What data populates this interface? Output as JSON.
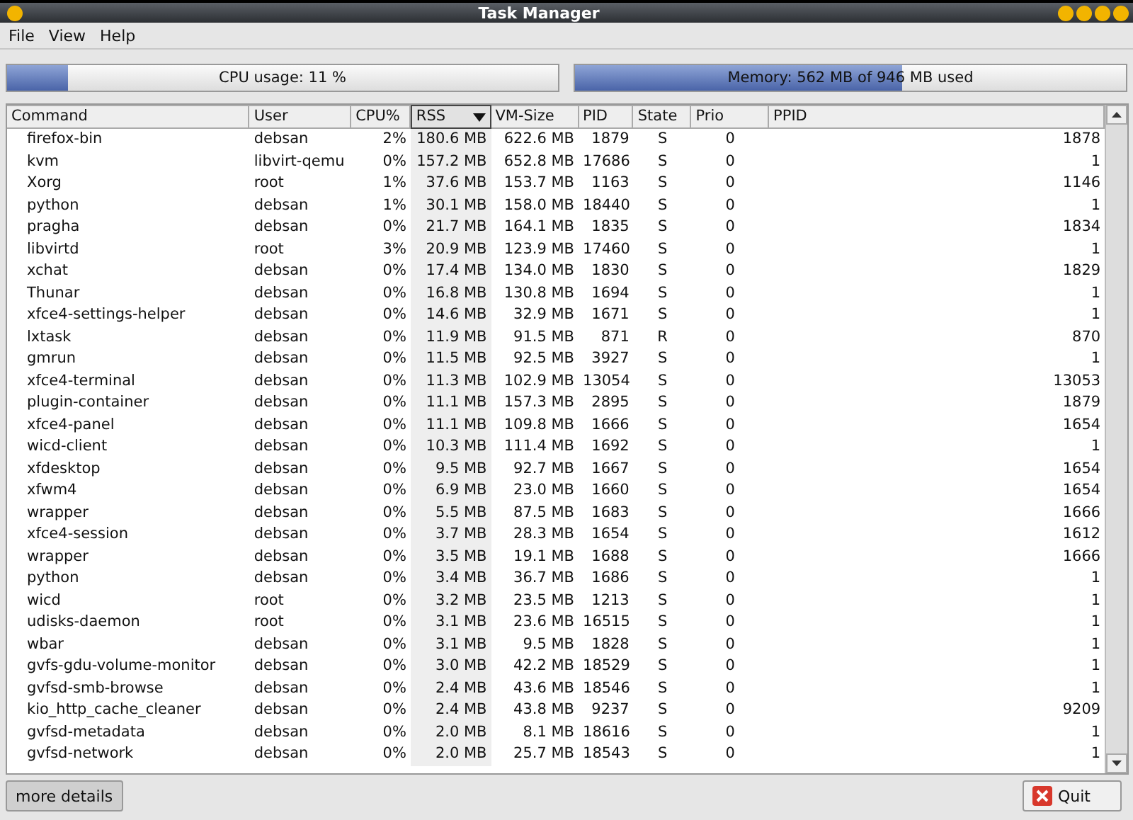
{
  "window": {
    "title": "Task Manager"
  },
  "menu": [
    "File",
    "View",
    "Help"
  ],
  "cpu": {
    "label": "CPU usage: 11 %",
    "level": 0.11
  },
  "memory": {
    "label": "Memory: 562 MB of 946 MB used",
    "level": 0.594
  },
  "table": {
    "columns": [
      {
        "label": "Command",
        "sorted": false
      },
      {
        "label": "User",
        "sorted": false
      },
      {
        "label": "CPU%",
        "sorted": false
      },
      {
        "label": "RSS",
        "sorted": true
      },
      {
        "label": "VM-Size",
        "sorted": false
      },
      {
        "label": "PID",
        "sorted": false
      },
      {
        "label": "State",
        "sorted": false
      },
      {
        "label": "Prio",
        "sorted": false
      },
      {
        "label": "PPID",
        "sorted": false
      }
    ],
    "rows": [
      [
        "firefox-bin",
        "debsan",
        "2%",
        "180.6 MB",
        "622.6 MB",
        "1879",
        "S",
        "0",
        "1878"
      ],
      [
        "kvm",
        "libvirt-qemu",
        "0%",
        "157.2 MB",
        "652.8 MB",
        "17686",
        "S",
        "0",
        "1"
      ],
      [
        "Xorg",
        "root",
        "1%",
        "37.6 MB",
        "153.7 MB",
        "1163",
        "S",
        "0",
        "1146"
      ],
      [
        "python",
        "debsan",
        "1%",
        "30.1 MB",
        "158.0 MB",
        "18440",
        "S",
        "0",
        "1"
      ],
      [
        "pragha",
        "debsan",
        "0%",
        "21.7 MB",
        "164.1 MB",
        "1835",
        "S",
        "0",
        "1834"
      ],
      [
        "libvirtd",
        "root",
        "3%",
        "20.9 MB",
        "123.9 MB",
        "17460",
        "S",
        "0",
        "1"
      ],
      [
        "xchat",
        "debsan",
        "0%",
        "17.4 MB",
        "134.0 MB",
        "1830",
        "S",
        "0",
        "1829"
      ],
      [
        "Thunar",
        "debsan",
        "0%",
        "16.8 MB",
        "130.8 MB",
        "1694",
        "S",
        "0",
        "1"
      ],
      [
        "xfce4-settings-helper",
        "debsan",
        "0%",
        "14.6 MB",
        "32.9 MB",
        "1671",
        "S",
        "0",
        "1"
      ],
      [
        "lxtask",
        "debsan",
        "0%",
        "11.9 MB",
        "91.5 MB",
        "871",
        "R",
        "0",
        "870"
      ],
      [
        "gmrun",
        "debsan",
        "0%",
        "11.5 MB",
        "92.5 MB",
        "3927",
        "S",
        "0",
        "1"
      ],
      [
        "xfce4-terminal",
        "debsan",
        "0%",
        "11.3 MB",
        "102.9 MB",
        "13054",
        "S",
        "0",
        "13053"
      ],
      [
        "plugin-container",
        "debsan",
        "0%",
        "11.1 MB",
        "157.3 MB",
        "2895",
        "S",
        "0",
        "1879"
      ],
      [
        "xfce4-panel",
        "debsan",
        "0%",
        "11.1 MB",
        "109.8 MB",
        "1666",
        "S",
        "0",
        "1654"
      ],
      [
        "wicd-client",
        "debsan",
        "0%",
        "10.3 MB",
        "111.4 MB",
        "1692",
        "S",
        "0",
        "1"
      ],
      [
        "xfdesktop",
        "debsan",
        "0%",
        "9.5 MB",
        "92.7 MB",
        "1667",
        "S",
        "0",
        "1654"
      ],
      [
        "xfwm4",
        "debsan",
        "0%",
        "6.9 MB",
        "23.0 MB",
        "1660",
        "S",
        "0",
        "1654"
      ],
      [
        "wrapper",
        "debsan",
        "0%",
        "5.5 MB",
        "87.5 MB",
        "1683",
        "S",
        "0",
        "1666"
      ],
      [
        "xfce4-session",
        "debsan",
        "0%",
        "3.7 MB",
        "28.3 MB",
        "1654",
        "S",
        "0",
        "1612"
      ],
      [
        "wrapper",
        "debsan",
        "0%",
        "3.5 MB",
        "19.1 MB",
        "1688",
        "S",
        "0",
        "1666"
      ],
      [
        "python",
        "debsan",
        "0%",
        "3.4 MB",
        "36.7 MB",
        "1686",
        "S",
        "0",
        "1"
      ],
      [
        "wicd",
        "root",
        "0%",
        "3.2 MB",
        "23.5 MB",
        "1213",
        "S",
        "0",
        "1"
      ],
      [
        "udisks-daemon",
        "root",
        "0%",
        "3.1 MB",
        "23.6 MB",
        "16515",
        "S",
        "0",
        "1"
      ],
      [
        "wbar",
        "debsan",
        "0%",
        "3.1 MB",
        "9.5 MB",
        "1828",
        "S",
        "0",
        "1"
      ],
      [
        "gvfs-gdu-volume-monitor",
        "debsan",
        "0%",
        "3.0 MB",
        "42.2 MB",
        "18529",
        "S",
        "0",
        "1"
      ],
      [
        "gvfsd-smb-browse",
        "debsan",
        "0%",
        "2.4 MB",
        "43.6 MB",
        "18546",
        "S",
        "0",
        "1"
      ],
      [
        "kio_http_cache_cleaner",
        "debsan",
        "0%",
        "2.4 MB",
        "43.8 MB",
        "9237",
        "S",
        "0",
        "9209"
      ],
      [
        "gvfsd-metadata",
        "debsan",
        "0%",
        "2.0 MB",
        "8.1 MB",
        "18616",
        "S",
        "0",
        "1"
      ],
      [
        "gvfsd-network",
        "debsan",
        "0%",
        "2.0 MB",
        "25.7 MB",
        "18543",
        "S",
        "0",
        "1"
      ]
    ]
  },
  "buttons": {
    "details": "more details",
    "quit": "Quit"
  }
}
